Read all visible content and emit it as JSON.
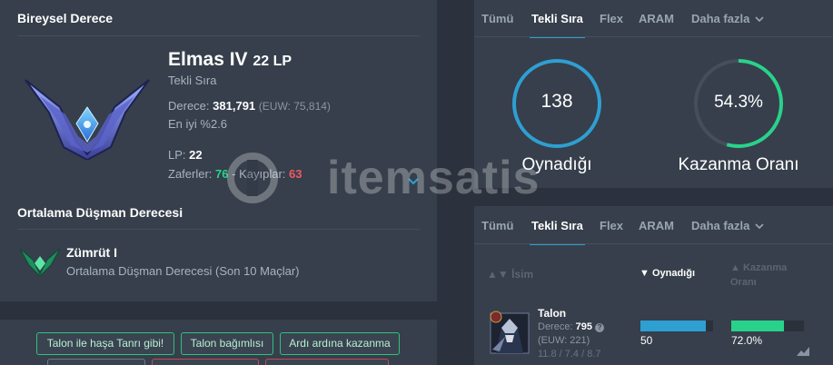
{
  "solo": {
    "title": "Bireysel Derece",
    "rank_name": "Elmas IV",
    "lp_badge": "22 LP",
    "queue": "Tekli Sıra",
    "rank_label": "Derece:",
    "rank_value": "381,791",
    "rank_euw": "(EUW: 75,814)",
    "top_percent": "En iyi %2.6",
    "lp_label": "LP:",
    "lp_value": "22",
    "wins_label": "Zaferler:",
    "wins": "76",
    "sep": "-",
    "losses_label": "Kayıplar:",
    "losses": "63"
  },
  "enemy": {
    "title": "Ortalama Düşman Derecesi",
    "rank": "Zümrüt I",
    "desc": "Ortalama Düşman Derecesi (Son 10 Maçlar)"
  },
  "tags": [
    "Talon ile haşa Tanrı gibi!",
    "Talon bağımlısı",
    "Ardı ardına kazanma"
  ],
  "top_tabs": [
    "Tümü",
    "Tekli Sıra",
    "Flex",
    "ARAM",
    "Daha fazla"
  ],
  "stats": {
    "played_value": "138",
    "played_label": "Oynadığı",
    "winrate_value": "54.3%",
    "winrate_label": "Kazanma Oranı",
    "winrate_fraction": 0.543
  },
  "bottom_tabs": [
    "Tümü",
    "Tekli Sıra",
    "Flex",
    "ARAM",
    "Daha fazla"
  ],
  "table": {
    "col_name": "İsim",
    "col_played": "Oynadığı",
    "col_winrate_1": "Kazanma",
    "col_winrate_2": "Oranı",
    "row": {
      "champion": "Talon",
      "rank_label": "Derece:",
      "rank_value": "795",
      "euw": "(EUW: 221)",
      "kda": "11.8 / 7.4 / 8.7",
      "played": "50",
      "played_fraction": 0.9,
      "winrate": "72.0%",
      "winrate_fraction": 0.72
    }
  },
  "watermark": "itemsatis",
  "colors": {
    "accent_blue": "#2e9fd2",
    "accent_green": "#29d28a",
    "loss_red": "#ef5a60"
  }
}
